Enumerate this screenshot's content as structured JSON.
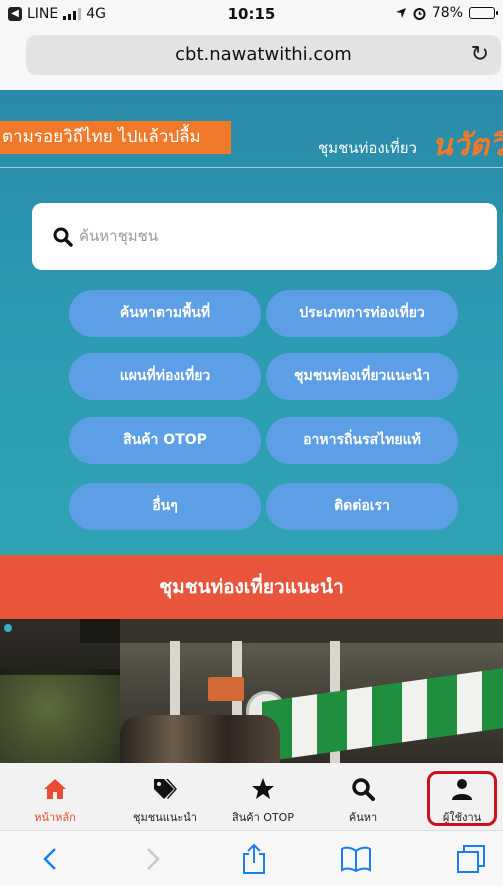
{
  "status_bar": {
    "back_app_label": "LINE",
    "network": "4G",
    "time": "10:15",
    "battery": "78%",
    "battery_level": 0.78
  },
  "url_bar": {
    "url": "cbt.nawatwithi.com",
    "reload_icon": "reload-icon"
  },
  "hero": {
    "slogan": "ตามรอยวิถีไทย ไปแล้วปลื้ม",
    "brand_subtitle": "ชุมชนท่องเที่ยว",
    "brand_name": "นวัตวิถี",
    "search_placeholder": "ค้นหาชุมชน"
  },
  "menu": {
    "buttons": [
      "ค้นหาตามพื้นที่",
      "ประเภทการท่องเที่ยว",
      "แผนที่ท่องเที่ยว",
      "ชุมชนท่องเที่ยวแนะนำ",
      "สินค้า OTOP",
      "อาหารถิ่นรสไทยแท้",
      "อื่นๆ",
      "ติดต่อเรา"
    ]
  },
  "section": {
    "title": "ชุมชนท่องเที่ยวแนะนำ"
  },
  "bottom_nav": {
    "items": [
      {
        "label": "หน้าหลัก",
        "icon": "home-icon",
        "active": true
      },
      {
        "label": "ชุมชนแนะนำ",
        "icon": "tags-icon",
        "active": false
      },
      {
        "label": "สินค้า OTOP",
        "icon": "star-icon",
        "active": false
      },
      {
        "label": "ค้นหา",
        "icon": "search-icon",
        "active": false
      },
      {
        "label": "ผู้ใช้งาน",
        "icon": "user-icon",
        "active": false
      }
    ]
  },
  "colors": {
    "accent_orange": "#f07a2a",
    "section_red": "#e8553b",
    "button_blue": "#5d9fe6",
    "active_nav": "#e94b35",
    "highlight_red": "#d10f1b"
  }
}
